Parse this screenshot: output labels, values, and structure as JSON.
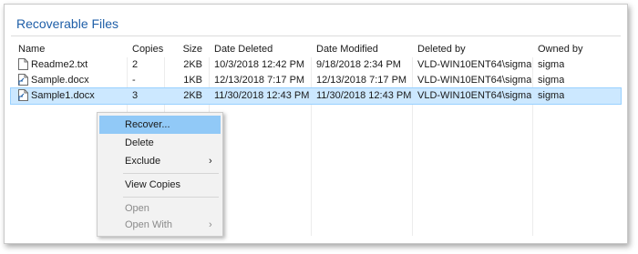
{
  "panel": {
    "title": "Recoverable Files"
  },
  "table": {
    "columns": {
      "name": "Name",
      "copies": "Copies",
      "size": "Size",
      "deleted": "Date Deleted",
      "modified": "Date Modified",
      "deleted_by": "Deleted by",
      "owned_by": "Owned by"
    },
    "rows": [
      {
        "name": "Readme2.txt",
        "copies": "2",
        "size": "2KB",
        "deleted": "10/3/2018 12:42 PM",
        "modified": "9/18/2018 2:34 PM",
        "deleted_by": "VLD-WIN10ENT64\\sigma",
        "owned_by": "sigma",
        "icon": "text-file-icon"
      },
      {
        "name": "Sample.docx",
        "copies": "-",
        "size": "1KB",
        "deleted": "12/13/2018 7:17 PM",
        "modified": "12/13/2018 7:17 PM",
        "deleted_by": "VLD-WIN10ENT64\\sigma",
        "owned_by": "sigma",
        "icon": "shortcut-file-icon"
      },
      {
        "name": "Sample1.docx",
        "copies": "3",
        "size": "2KB",
        "deleted": "11/30/2018 12:43 PM",
        "modified": "11/30/2018 12:43 PM",
        "deleted_by": "VLD-WIN10ENT64\\sigma",
        "owned_by": "sigma",
        "icon": "shortcut-file-icon",
        "selected": true
      }
    ]
  },
  "context_menu": {
    "recover": "Recover...",
    "delete": "Delete",
    "exclude": "Exclude",
    "view_copies": "View Copies",
    "open": "Open",
    "open_with": "Open With",
    "submenu_arrow": "›"
  },
  "colors": {
    "title": "#1f5fa8",
    "selection": "#cce8ff",
    "menu_hover": "#91c9f7"
  }
}
